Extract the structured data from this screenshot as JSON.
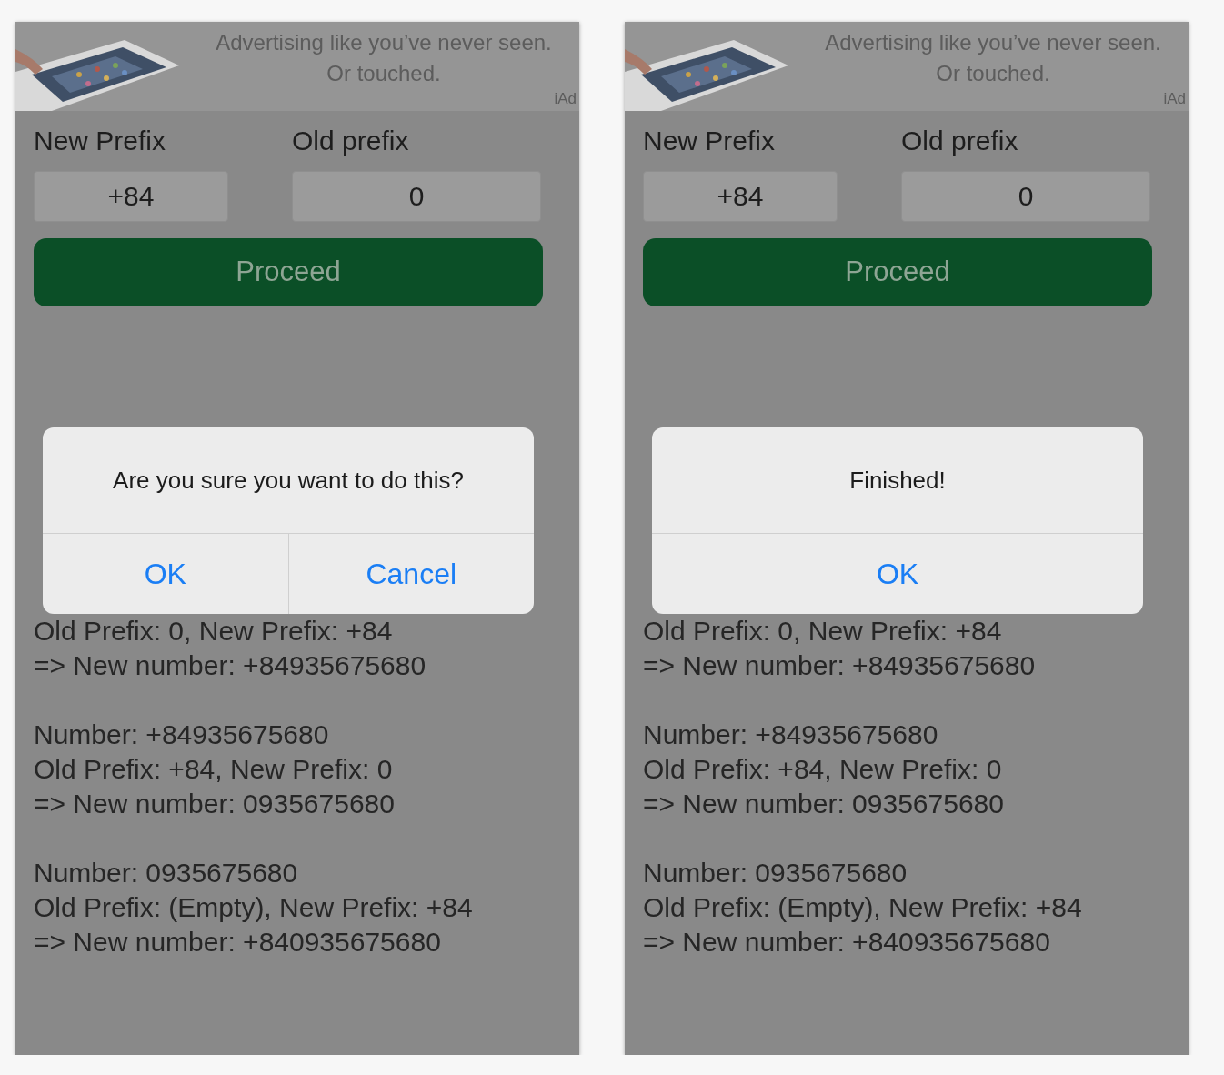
{
  "screens": [
    {
      "ad": {
        "kind": "picture",
        "headline": "Advertising like you’ve never seen.",
        "subline": "Or touched.",
        "badge": "iAd"
      },
      "new_prefix": {
        "label": "New Prefix",
        "value": "+84"
      },
      "old_prefix": {
        "label": "Old prefix",
        "value": "0"
      },
      "proceed_button": "Proceed",
      "log": [
        [
          "Old Prefix: 0, New Prefix: +84",
          "=> New number: +84935675680"
        ],
        [
          "Number: +84935675680",
          "Old Prefix: +84, New Prefix: 0",
          "=> New number: 0935675680"
        ],
        [
          "Number: 0935675680",
          "Old Prefix: (Empty), New Prefix: +84",
          "=> New number: +840935675680"
        ]
      ],
      "alert": {
        "message": "Are you sure you want to do this?",
        "buttons": [
          "OK",
          "Cancel"
        ]
      }
    },
    {
      "ad": {
        "kind": "picture",
        "headline": "Advertising like you’ve never seen.",
        "subline": "Or touched.",
        "badge": "iAd"
      },
      "new_prefix": {
        "label": "New Prefix",
        "value": "+84"
      },
      "old_prefix": {
        "label": "Old prefix",
        "value": "0"
      },
      "proceed_button": "Proceed",
      "log": [
        [
          "Old Prefix: 0, New Prefix: +84",
          "=> New number: +84935675680"
        ],
        [
          "Number: +84935675680",
          "Old Prefix: +84, New Prefix: 0",
          "=> New number: 0935675680"
        ],
        [
          "Number: 0935675680",
          "Old Prefix: (Empty), New Prefix: +84",
          "=> New number: +840935675680"
        ]
      ],
      "alert": {
        "message": "Finished!",
        "buttons": [
          "OK"
        ]
      }
    }
  ]
}
